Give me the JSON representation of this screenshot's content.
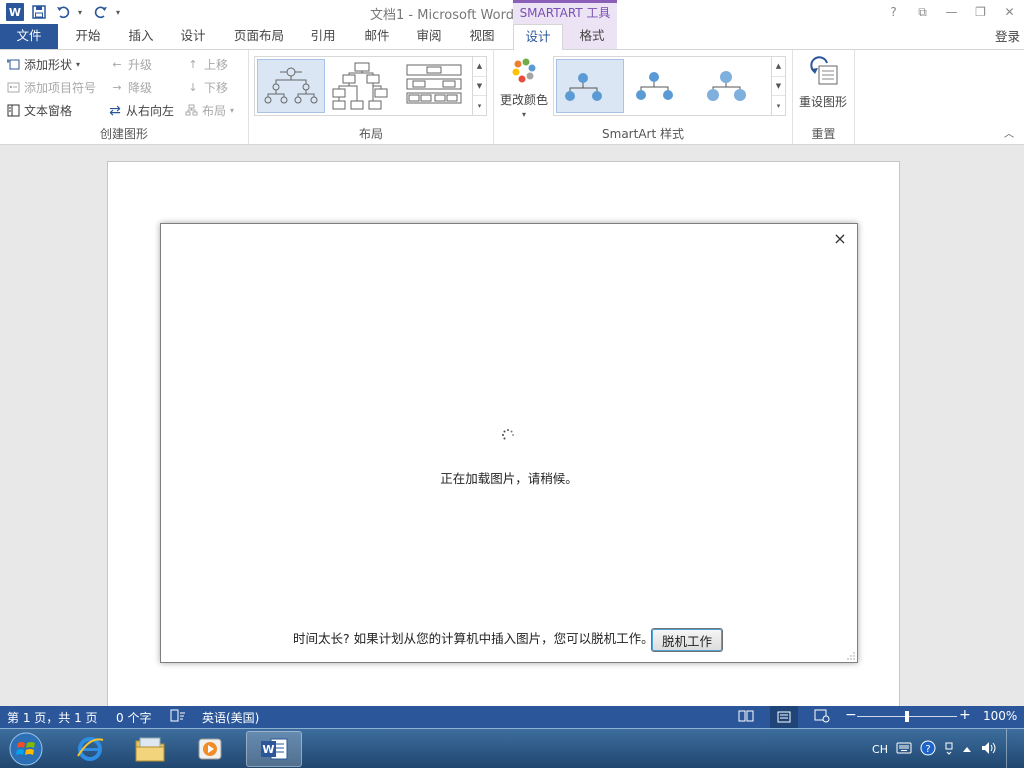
{
  "window": {
    "title": "文档1 - Microsoft Word",
    "context_tab_group": "SMARTART 工具",
    "controls": [
      "?",
      "⧉",
      "—",
      "❐",
      "✕"
    ]
  },
  "quick_access": {
    "app_icon": "W"
  },
  "tabs": [
    {
      "label": "文件"
    },
    {
      "label": "开始"
    },
    {
      "label": "插入"
    },
    {
      "label": "设计"
    },
    {
      "label": "页面布局"
    },
    {
      "label": "引用"
    },
    {
      "label": "邮件"
    },
    {
      "label": "审阅"
    },
    {
      "label": "视图"
    },
    {
      "label": "设计"
    },
    {
      "label": "格式"
    }
  ],
  "signin_label": "登录",
  "ribbon": {
    "create_graphic": {
      "label": "创建图形",
      "add_shape": "添加形状",
      "add_bullet": "添加项目符号",
      "text_pane": "文本窗格",
      "promote": "升级",
      "demote": "降级",
      "right_to_left": "从右向左",
      "move_up": "上移",
      "move_down": "下移",
      "layout": "布局"
    },
    "layouts": {
      "label": "布局"
    },
    "smartart_styles": {
      "label": "SmartArt 样式",
      "change_colors": "更改颜色"
    },
    "reset": {
      "label": "重置",
      "reset_graphic": "重设图形"
    }
  },
  "dialog": {
    "close": "×",
    "loading_text": "正在加载图片，请稍候。",
    "footer_text": "时间太长? 如果计划从您的计算机中插入图片，您可以脱机工作。",
    "offline_button": "脱机工作"
  },
  "statusbar": {
    "page": "第 1 页，共 1 页",
    "words": "0 个字",
    "language": "英语(美国)",
    "zoom_minus": "−",
    "zoom_plus": "+",
    "zoom": "100%",
    "zoom_level": 0.5
  },
  "taskbar": {
    "ime": "CH"
  },
  "colors": {
    "word_blue": "#2b579a",
    "smartart_purple": "#7b4fb0",
    "smartart_tab_bg": "#ece4f5",
    "smartart_node": "#5b9bd5"
  }
}
